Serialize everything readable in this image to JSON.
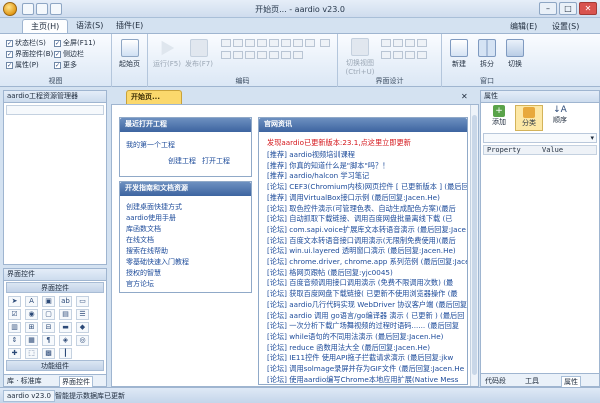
{
  "window": {
    "title": "开始页... - aardio v23.0",
    "controls": {
      "minimize": "–",
      "maximize": "□",
      "close": "✕"
    }
  },
  "tabs": {
    "items": [
      "主页(H)",
      "语法(S)",
      "插件(E)"
    ],
    "right_links": [
      "编辑(E)",
      "设置(S)"
    ]
  },
  "ribbon": {
    "view": {
      "checks": [
        {
          "label": "状态栏(S)",
          "checked": true
        },
        {
          "label": "全屏(F11)",
          "checked": false
        },
        {
          "label": "界面控件(B)",
          "checked": true
        },
        {
          "label": "侧边栏",
          "checked": true
        },
        {
          "label": "属性(P)",
          "checked": true
        },
        {
          "label": "更多",
          "checked": false
        }
      ],
      "start_page": "起始页",
      "label": "视图"
    },
    "code": {
      "run": "运行(F5)",
      "publish": "发布(F7)",
      "label": "编码"
    },
    "design": {
      "toggle": "切换视图",
      "toggle_sub": "(Ctrl+U)",
      "label": "界面设计"
    },
    "window": {
      "new": "新建",
      "split": "拆分",
      "switch": "切换",
      "label": "窗口"
    }
  },
  "left_top": {
    "title": "aardio工程资源管理器"
  },
  "left_bottom": {
    "title": "界面控件",
    "section1": "界面控件",
    "section2": "功能组件",
    "tabs": [
      "库 · 标准库",
      "界面控件"
    ]
  },
  "doc_tab": "开始页...",
  "recent": {
    "title": "最近打开工程",
    "items": [
      "我的第一个工程",
      "创建工程",
      "打开工程"
    ]
  },
  "guides": {
    "title": "开发指南和文档资源",
    "items": [
      "创建桌面快捷方式",
      "aardio使用手册",
      "库函数文档",
      "在线文档",
      "搜索在线帮助",
      "零基础快速入门教程",
      "授权的智慧",
      "官方论坛"
    ]
  },
  "news": {
    "title": "官网资讯",
    "headline": "发现aardio已更新版本:23.1,点这里立即更新",
    "items": [
      "[推荐] aardio视频培训课程",
      "[推荐] 你真的知道什么是\"脚本\"吗？！",
      "[推荐] aardio/halcon 学习笔记",
      "[论坛] CEF3(Chromium内核)网页控件 [ 已更新版本 ] (最后回",
      "[推荐] 调用VirtualBox接口示例 (最后回复:Jacen.He)",
      "[论坛] 取色控件演示(可管理色表、自动生成配色方案)(最后",
      "[论坛] 自动抓取下载链接、调用百度网盘批量离线下载 (已",
      "[论坛] com.sapi.voice扩展库文本转语音演示 (最后回复:Jace",
      "[论坛] 百度文本转语音接口调用演示(无限制免费使用)(最后",
      "[论坛] win.ui.layered 透明窗口演示 (最后回复:Jacen.He)",
      "[论坛] chrome.driver, chrome.app 系列范例 (最后回复:Jacen.",
      "[论坛] 格网页跟帖 (最后回复:yjc0045)",
      "[论坛] 百度音频调用接口调用演示 (免费不限调用次数) (最",
      "[论坛] 获取百度网盘下载链接( 已更新不使用浏览器操作 (最",
      "[论坛] aardio几行代码实现 WebDriver 协议客户端 (最后回复",
      "[论坛] aardio 调用 go语言/go编译器 演示 ( 已更新 ) (最后回",
      "[论坛] 一次分析下载广场舞视频的过程时语码...... (最后回复",
      "[论坛] while语句的不同用法演示 (最后回复:Jacen.He)",
      "[论坛] reduce 函数用法大全 (最后回复:Jacen.He)",
      "[论坛] IE11控件 使用API拖子拦截请求演示 (最后回复:jkw",
      "[论坛] 调用solmage录屏并存为GIF文件 (最后回复:Jacen.He",
      "[论坛] 使用aardio编写Chrome本地应用扩展(Native Mess"
    ]
  },
  "props": {
    "title": "属性",
    "add": "添加",
    "category": "分类",
    "order": "顺序",
    "col_property": "Property",
    "col_value": "Value",
    "tabs": [
      "代码段",
      "工具",
      "属性"
    ]
  },
  "status": {
    "version": "aardio v23.0",
    "message": "智能提示数据库已更新"
  },
  "colors": {
    "accent": "#3d64a0",
    "doc_tab": "#fbd86c",
    "headline": "#d4161b",
    "link": "#1d4b9a"
  }
}
